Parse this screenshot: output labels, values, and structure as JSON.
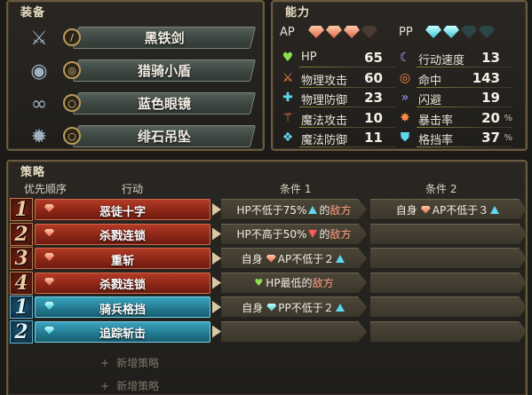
{
  "equipment": {
    "title": "装备",
    "items": [
      {
        "name": "黑铁剑",
        "icon": "sword-icon",
        "slot_icon": "sword-slot-icon"
      },
      {
        "name": "猎骑小盾",
        "icon": "shield-icon",
        "slot_icon": "shield-slot-icon"
      },
      {
        "name": "蓝色眼镜",
        "icon": "glasses-icon",
        "slot_icon": "ring-slot-icon"
      },
      {
        "name": "绯石吊坠",
        "icon": "pendant-icon",
        "slot_icon": "ring-slot-icon"
      }
    ]
  },
  "stats": {
    "title": "能力",
    "ap_label": "AP",
    "pp_label": "PP",
    "ap_gems": {
      "filled": 3,
      "total": 4
    },
    "pp_gems": {
      "filled": 2,
      "total": 4
    },
    "left": [
      {
        "name": "HP",
        "value": "65",
        "icon": "heart-icon"
      },
      {
        "name": "物理攻击",
        "value": "60",
        "icon": "sword-icon"
      },
      {
        "name": "物理防御",
        "value": "23",
        "icon": "armor-icon"
      },
      {
        "name": "魔法攻击",
        "value": "10",
        "icon": "wand-icon"
      },
      {
        "name": "魔法防御",
        "value": "11",
        "icon": "robe-icon"
      }
    ],
    "right": [
      {
        "name": "行动速度",
        "value": "13",
        "unit": "",
        "icon": "scythe-icon"
      },
      {
        "name": "命中",
        "value": "143",
        "unit": "",
        "icon": "target-icon"
      },
      {
        "name": "闪避",
        "value": "19",
        "unit": "",
        "icon": "dodge-icon"
      },
      {
        "name": "暴击率",
        "value": "20",
        "unit": "%",
        "icon": "burst-icon"
      },
      {
        "name": "格挡率",
        "value": "37",
        "unit": "%",
        "icon": "block-icon"
      }
    ]
  },
  "strategy": {
    "title": "策略",
    "headers": {
      "priority": "优先顺序",
      "action": "行动",
      "cond1": "条件 1",
      "cond2": "条件 2"
    },
    "rows": [
      {
        "priority": "1",
        "type": "red",
        "action": "恶徒十字",
        "c1": {
          "prefix": "HP不低于75%",
          "arrow": "up",
          "mid": "的",
          "target": "敌方"
        },
        "c2": {
          "prefix": "自身",
          "gem": "ap",
          "text": "AP不低于３",
          "arrow": "up"
        }
      },
      {
        "priority": "2",
        "type": "red",
        "action": "杀戮连锁",
        "c1": {
          "prefix": "HP不高于50%",
          "arrow": "down",
          "mid": "的",
          "target": "敌方"
        },
        "c2": null
      },
      {
        "priority": "3",
        "type": "red",
        "action": "重斩",
        "c1": {
          "prefix": "自身",
          "gem": "ap",
          "text": "AP不低于２",
          "arrow": "up"
        },
        "c2": null
      },
      {
        "priority": "4",
        "type": "red",
        "action": "杀戮连锁",
        "c1": {
          "heart": true,
          "text": "HP最低的",
          "target": "敌方"
        },
        "c2": null
      },
      {
        "priority": "1",
        "type": "blue",
        "action": "骑兵格挡",
        "c1": {
          "prefix": "自身",
          "gem": "pp",
          "text": "PP不低于２",
          "arrow": "up"
        },
        "c2": null
      },
      {
        "priority": "2",
        "type": "blue",
        "action": "追踪斩击",
        "c1": null,
        "c2": null
      }
    ],
    "add_labels": [
      "新增策略",
      "新增策略"
    ],
    "add_symbol": "+"
  },
  "colors": {
    "ap_gem": "#e0674a",
    "pp_gem": "#3ec4d2",
    "red_action": "#8a2516",
    "blue_action": "#22788e",
    "enemy_text": "#ff9f86"
  }
}
